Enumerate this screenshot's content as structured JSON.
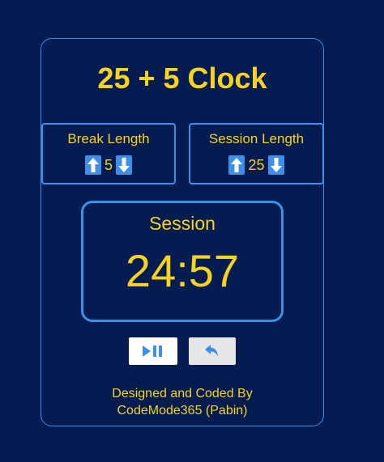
{
  "app": {
    "title": "25 + 5 Clock"
  },
  "break_length": {
    "label": "Break Length",
    "value": "5",
    "increment_icon": "arrow-up-icon",
    "decrement_icon": "arrow-down-icon"
  },
  "session_length": {
    "label": "Session Length",
    "value": "25",
    "increment_icon": "arrow-up-icon",
    "decrement_icon": "arrow-down-icon"
  },
  "timer": {
    "label": "Session",
    "time": "24:57"
  },
  "controls": {
    "play_pause_icon": "play-pause-icon",
    "reset_icon": "reset-icon"
  },
  "footer": {
    "line1": "Designed and Coded By",
    "line2": "CodeMode365 (Pabin)"
  },
  "colors": {
    "background": "#051c52",
    "accent": "#3d8fe8",
    "text": "#f7d21e"
  }
}
